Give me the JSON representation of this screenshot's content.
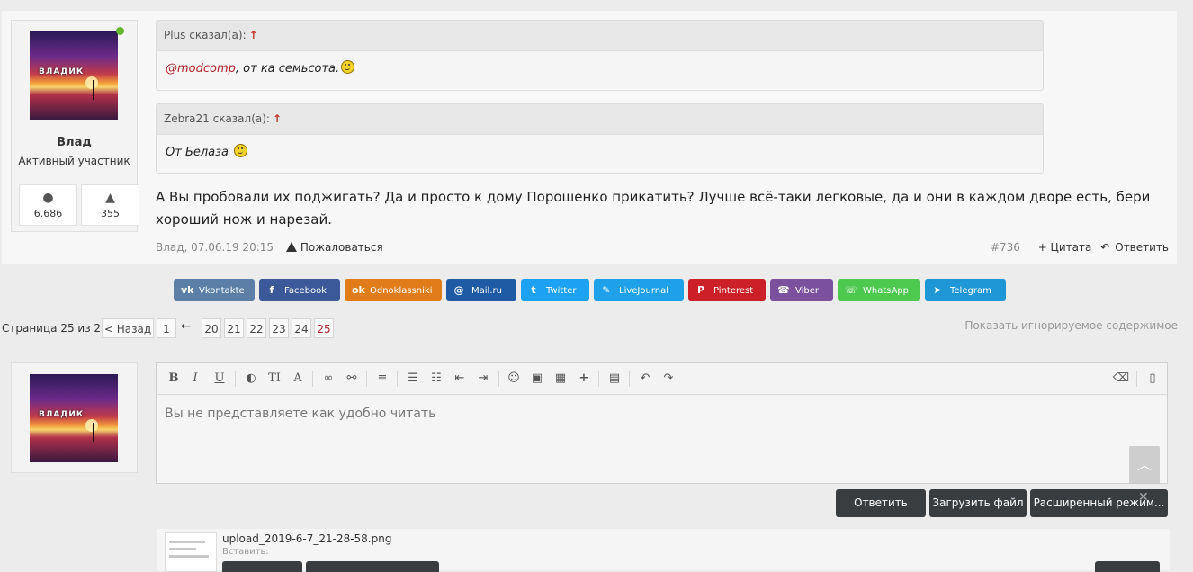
{
  "post": {
    "user": {
      "name": "Влад",
      "rank": "Активный участник",
      "avatar_text": "ВЛАДИК",
      "messages_count": "6.686",
      "likes_count": "355"
    },
    "quotes": [
      {
        "author_label": "Plus сказал(а):",
        "arrow": "↑",
        "mention": "@modcomp",
        "text": ", от ка семьсота."
      },
      {
        "author_label": "Zebra21 сказал(а):",
        "arrow": "↑",
        "text": "От Белаза"
      }
    ],
    "body_line1": "А Вы пробовали их поджигать? Да и просто к дому Порошенко прикатить? Лучше всё-таки легковые, да и они в каждом дворе есть, бери",
    "body_line2": "хороший нож и нарезай.",
    "meta": "Влад, 07.06.19 20:15",
    "report": "Пожаловаться",
    "number": "#736",
    "quote_action": "+ Цитата",
    "reply_action": "Ответить"
  },
  "share": [
    {
      "label": "Vkontakte",
      "icon": "vk-icon",
      "glyph": "vk",
      "color": "#5b7fa6"
    },
    {
      "label": "Facebook",
      "icon": "facebook-icon",
      "glyph": "f",
      "color": "#3b5998"
    },
    {
      "label": "Odnoklassniki",
      "icon": "odnoklassniki-icon",
      "glyph": "ok",
      "color": "#e07d1a"
    },
    {
      "label": "Mail.ru",
      "icon": "mailru-icon",
      "glyph": "@",
      "color": "#1f5aa5"
    },
    {
      "label": "Twitter",
      "icon": "twitter-icon",
      "glyph": "t",
      "color": "#1da1f2"
    },
    {
      "label": "LiveJournal",
      "icon": "livejournal-icon",
      "glyph": "✎",
      "color": "#1ea1e8"
    },
    {
      "label": "Pinterest",
      "icon": "pinterest-icon",
      "glyph": "P",
      "color": "#cb2027"
    },
    {
      "label": "Viber",
      "icon": "viber-icon",
      "glyph": "☎",
      "color": "#7b519d"
    },
    {
      "label": "WhatsApp",
      "icon": "whatsapp-icon",
      "glyph": "☏",
      "color": "#4cc94e"
    },
    {
      "label": "Telegram",
      "icon": "telegram-icon",
      "glyph": "➤",
      "color": "#1f96d6"
    }
  ],
  "pager": {
    "label": "Страница 25 из 25",
    "prev": "< Назад",
    "first": "1",
    "separator": "←",
    "pages": [
      "20",
      "21",
      "22",
      "23",
      "24",
      "25"
    ],
    "current": "25"
  },
  "show_ignored": "Показать игнорируемое содержимое",
  "editor": {
    "text": "Вы не представляете как удобно читать",
    "toolbar": [
      "bold-icon",
      "italic-icon",
      "underline-icon",
      "color-icon",
      "font-size-icon",
      "font-icon",
      "link-icon",
      "unlink-icon",
      "align-icon",
      "bullet-list-icon",
      "numbered-list-icon",
      "outdent-icon",
      "indent-icon",
      "smilie-icon",
      "image-icon",
      "media-icon",
      "insert-icon",
      "save-draft-icon",
      "undo-icon",
      "redo-icon",
      "remove-format-icon",
      "source-icon"
    ]
  },
  "buttons": {
    "reply": "Ответить",
    "upload": "Загрузить файл",
    "advanced": "Расширенный режим..."
  },
  "attachment": {
    "filename": "upload_2019-6-7_21-28-58.png",
    "insert_label": "Вставить:"
  }
}
